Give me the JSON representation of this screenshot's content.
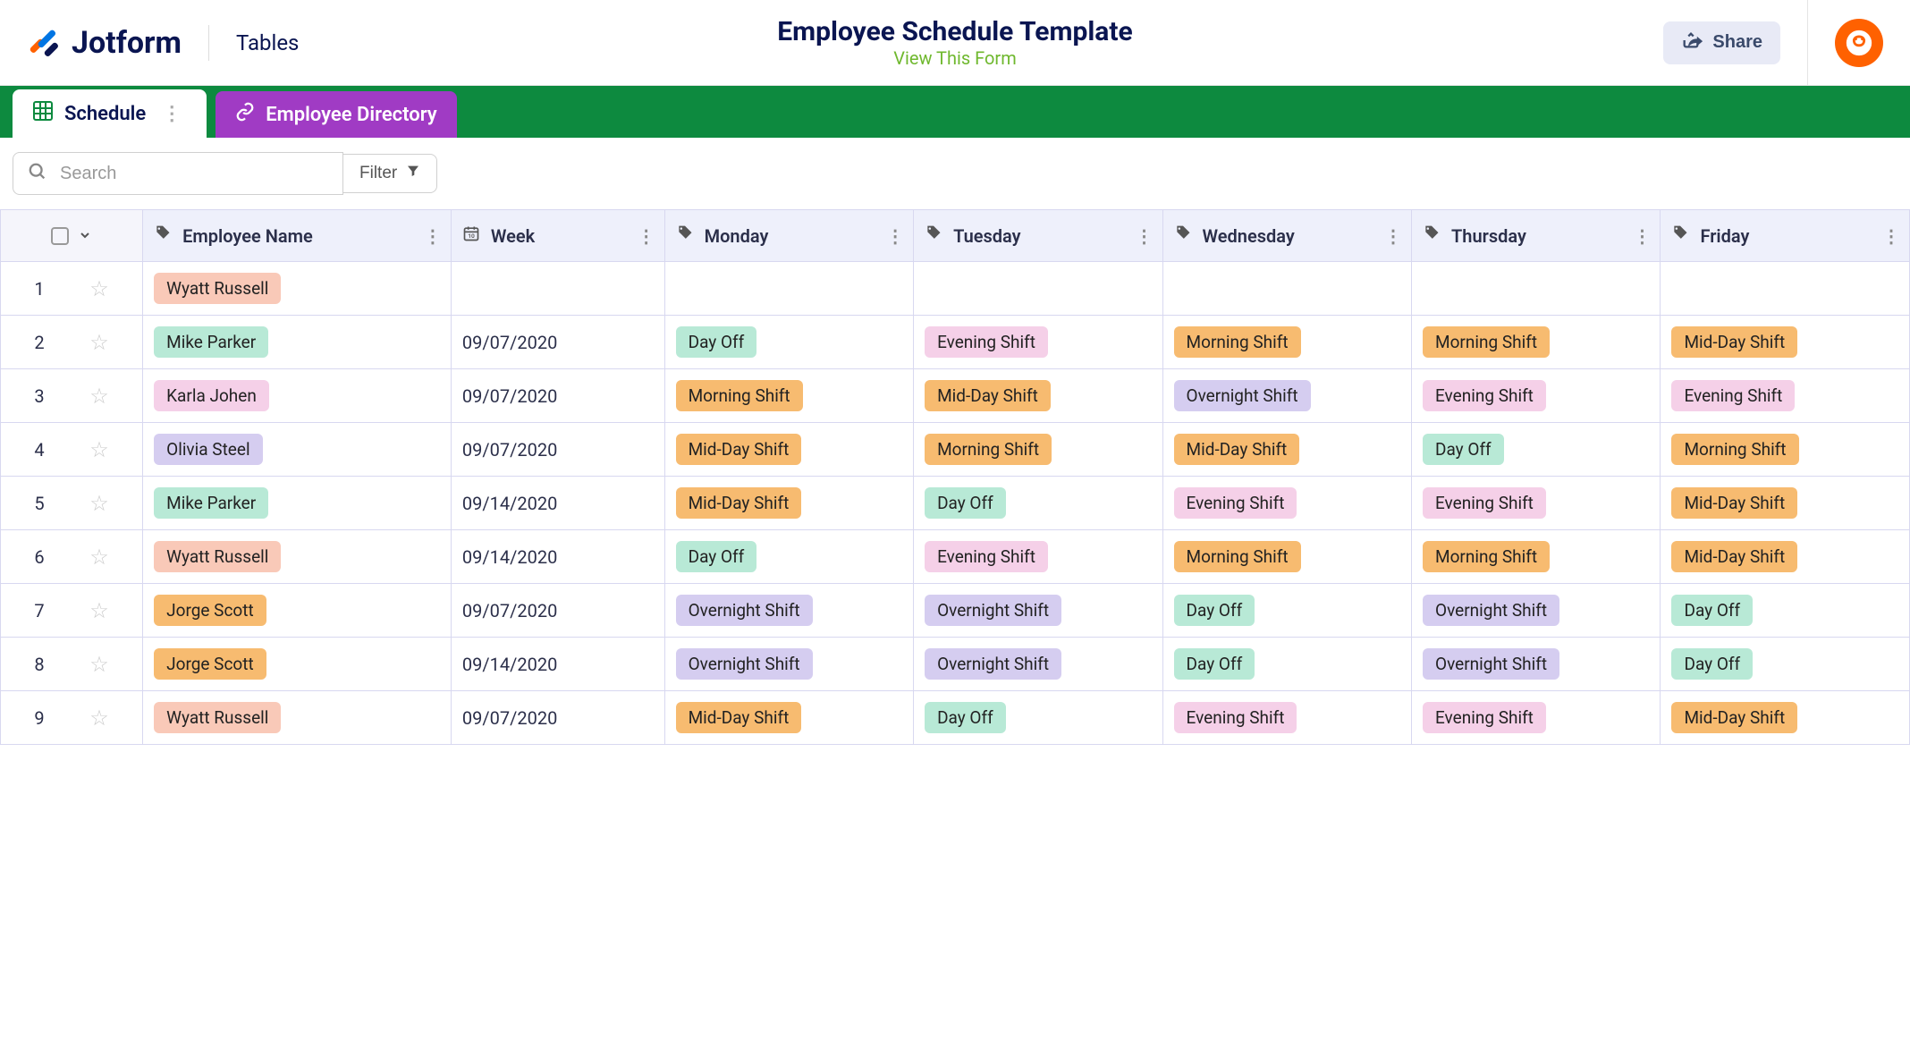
{
  "header": {
    "brand": "Jotform",
    "section": "Tables",
    "title": "Employee Schedule Template",
    "view_link": "View This Form",
    "share_label": "Share"
  },
  "tabs": [
    {
      "label": "Schedule",
      "active": true
    },
    {
      "label": "Employee Directory",
      "active": false
    }
  ],
  "toolbar": {
    "search_placeholder": "Search",
    "filter_label": "Filter"
  },
  "columns": [
    {
      "key": "name",
      "label": "Employee Name",
      "icon": "tag"
    },
    {
      "key": "week",
      "label": "Week",
      "icon": "calendar"
    },
    {
      "key": "mon",
      "label": "Monday",
      "icon": "tag"
    },
    {
      "key": "tue",
      "label": "Tuesday",
      "icon": "tag"
    },
    {
      "key": "wed",
      "label": "Wednesday",
      "icon": "tag"
    },
    {
      "key": "thu",
      "label": "Thursday",
      "icon": "tag"
    },
    {
      "key": "fri",
      "label": "Friday",
      "icon": "tag"
    }
  ],
  "pill_colors": {
    "Wyatt Russell": "peach",
    "Mike Parker": "mint",
    "Karla Johen": "pink",
    "Olivia Steel": "lavender",
    "Jorge Scott": "orange",
    "Day Off": "mint",
    "Morning Shift": "orange",
    "Mid-Day Shift": "orange",
    "Evening Shift": "pink",
    "Overnight Shift": "lavender"
  },
  "rows": [
    {
      "num": "1",
      "name": "Wyatt Russell",
      "week": "",
      "mon": "",
      "tue": "",
      "wed": "",
      "thu": "",
      "fri": ""
    },
    {
      "num": "2",
      "name": "Mike Parker",
      "week": "09/07/2020",
      "mon": "Day Off",
      "tue": "Evening Shift",
      "wed": "Morning Shift",
      "thu": "Morning Shift",
      "fri": "Mid-Day Shift"
    },
    {
      "num": "3",
      "name": "Karla Johen",
      "week": "09/07/2020",
      "mon": "Morning Shift",
      "tue": "Mid-Day Shift",
      "wed": "Overnight Shift",
      "thu": "Evening Shift",
      "fri": "Evening Shift"
    },
    {
      "num": "4",
      "name": "Olivia Steel",
      "week": "09/07/2020",
      "mon": "Mid-Day Shift",
      "tue": "Morning Shift",
      "wed": "Mid-Day Shift",
      "thu": "Day Off",
      "fri": "Morning Shift"
    },
    {
      "num": "5",
      "name": "Mike Parker",
      "week": "09/14/2020",
      "mon": "Mid-Day Shift",
      "tue": "Day Off",
      "wed": "Evening Shift",
      "thu": "Evening Shift",
      "fri": "Mid-Day Shift"
    },
    {
      "num": "6",
      "name": "Wyatt Russell",
      "week": "09/14/2020",
      "mon": "Day Off",
      "tue": "Evening Shift",
      "wed": "Morning Shift",
      "thu": "Morning Shift",
      "fri": "Mid-Day Shift"
    },
    {
      "num": "7",
      "name": "Jorge Scott",
      "week": "09/07/2020",
      "mon": "Overnight Shift",
      "tue": "Overnight Shift",
      "wed": "Day Off",
      "thu": "Overnight Shift",
      "fri": "Day Off"
    },
    {
      "num": "8",
      "name": "Jorge Scott",
      "week": "09/14/2020",
      "mon": "Overnight Shift",
      "tue": "Overnight Shift",
      "wed": "Day Off",
      "thu": "Overnight Shift",
      "fri": "Day Off"
    },
    {
      "num": "9",
      "name": "Wyatt Russell",
      "week": "09/07/2020",
      "mon": "Mid-Day Shift",
      "tue": "Day Off",
      "wed": "Evening Shift",
      "thu": "Evening Shift",
      "fri": "Mid-Day Shift"
    }
  ]
}
